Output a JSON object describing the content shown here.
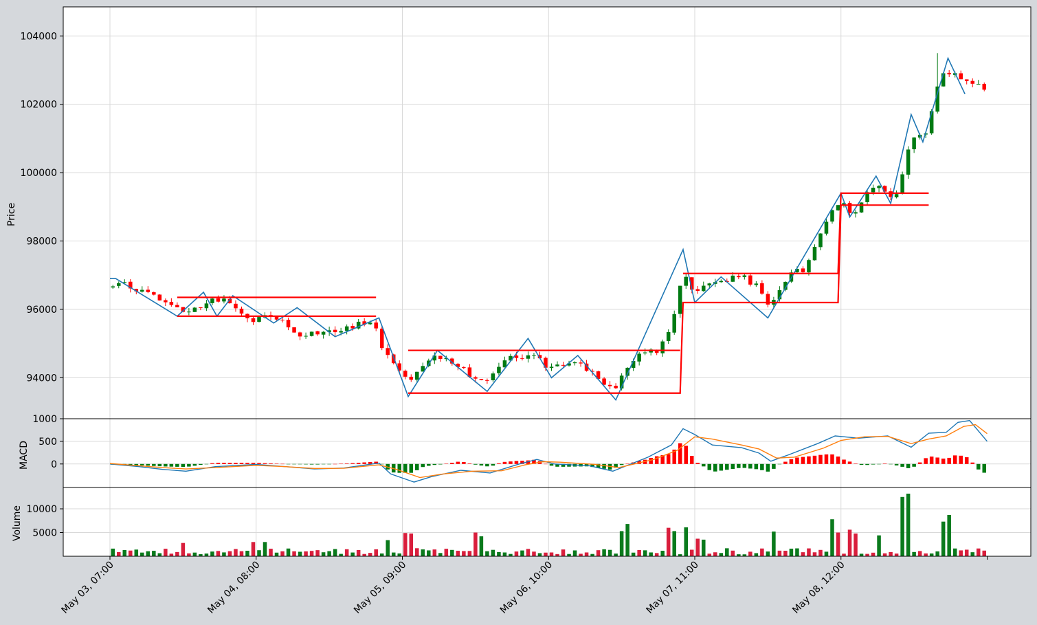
{
  "colors": {
    "figure_bg": "#d5d8dc",
    "panel_bg": "#ffffff",
    "grid": "#d9d9d9",
    "up": "#007a12",
    "down": "#ff0000",
    "volume_up": "#0a7a1c",
    "volume_down": "#d91e3c",
    "zigzag": "#1f77b4",
    "signal": "#ff7f0e",
    "levels": "#ff0000"
  },
  "chart_data": {
    "type": "candlestick",
    "x_tick_labels": [
      "May 03, 07:00",
      "May 04, 08:00",
      "May 05, 09:00",
      "May 06, 10:00",
      "May 07, 11:00",
      "May 08, 12:00"
    ],
    "x_tick_index": [
      0,
      25,
      50,
      75,
      100,
      125
    ],
    "bar_count": 150,
    "panels": {
      "price": {
        "ylabel": "Price",
        "yticks": [
          94000,
          96000,
          98000,
          100000,
          102000,
          104000
        ],
        "ylim": [
          92800,
          104850
        ],
        "anchors": [
          [
            0,
            96650
          ],
          [
            2,
            96800
          ],
          [
            11,
            96050
          ],
          [
            14,
            95950
          ],
          [
            17,
            96300
          ],
          [
            20,
            96250
          ],
          [
            24,
            95700
          ],
          [
            28,
            95850
          ],
          [
            32,
            95300
          ],
          [
            36,
            95250
          ],
          [
            40,
            95450
          ],
          [
            45,
            95650
          ],
          [
            47,
            94700
          ],
          [
            49,
            94300
          ],
          [
            51,
            93900
          ],
          [
            56,
            94650
          ],
          [
            60,
            94300
          ],
          [
            64,
            93800
          ],
          [
            67,
            94500
          ],
          [
            72,
            94700
          ],
          [
            75,
            94300
          ],
          [
            80,
            94400
          ],
          [
            86,
            93650
          ],
          [
            90,
            94700
          ],
          [
            94,
            94800
          ],
          [
            96,
            95500
          ],
          [
            98,
            97000
          ],
          [
            100,
            96500
          ],
          [
            104,
            96800
          ],
          [
            108,
            97000
          ],
          [
            111,
            96600
          ],
          [
            113,
            96100
          ],
          [
            116,
            97000
          ],
          [
            119,
            97200
          ],
          [
            123,
            98700
          ],
          [
            125,
            99200
          ],
          [
            127,
            98800
          ],
          [
            131,
            99700
          ],
          [
            134,
            99100
          ],
          [
            137,
            100900
          ],
          [
            140,
            101300
          ],
          [
            142,
            103000
          ],
          [
            144,
            102900
          ],
          [
            146,
            102700
          ],
          [
            149,
            102500
          ]
        ],
        "zigzag": [
          [
            0,
            96900
          ],
          [
            1,
            96900
          ],
          [
            11.5,
            95800
          ],
          [
            16,
            96500
          ],
          [
            18.3,
            95800
          ],
          [
            21,
            96400
          ],
          [
            28,
            95600
          ],
          [
            32,
            96050
          ],
          [
            38.5,
            95200
          ],
          [
            46,
            95750
          ],
          [
            51,
            93450
          ],
          [
            56,
            94800
          ],
          [
            64.5,
            93600
          ],
          [
            71.5,
            95150
          ],
          [
            75.5,
            94000
          ],
          [
            80,
            94650
          ],
          [
            86.5,
            93350
          ],
          [
            98,
            97750
          ],
          [
            100,
            96200
          ],
          [
            104.5,
            96950
          ],
          [
            112.5,
            95750
          ],
          [
            125,
            99400
          ],
          [
            126.5,
            98700
          ],
          [
            131,
            99900
          ],
          [
            133.5,
            99100
          ],
          [
            137,
            101700
          ],
          [
            139,
            100900
          ],
          [
            143.3,
            103350
          ],
          [
            146.2,
            102300
          ]
        ],
        "levels": [
          [
            [
              11.5,
              96350
            ],
            [
              45.5,
              96350
            ]
          ],
          [
            [
              11.5,
              95800
            ],
            [
              45.5,
              95800
            ]
          ],
          [
            [
              51,
              94800
            ],
            [
              97.5,
              94800
            ],
            [
              97.5,
              94800
            ]
          ],
          [
            [
              51,
              93550
            ],
            [
              97.5,
              93550
            ],
            [
              98,
              96200
            ],
            [
              124.5,
              96200
            ],
            [
              125,
              99050
            ],
            [
              140,
              99050
            ]
          ],
          [
            [
              98,
              97050
            ],
            [
              124.5,
              97050
            ],
            [
              125,
              99400
            ],
            [
              140,
              99400
            ]
          ]
        ]
      },
      "macd": {
        "ylabel": "MACD",
        "yticks": [
          0,
          500,
          1000
        ],
        "ylim": [
          -520,
          1000
        ],
        "macd_line": [
          [
            0,
            0
          ],
          [
            5,
            -60
          ],
          [
            9,
            -120
          ],
          [
            13,
            -160
          ],
          [
            18,
            -60
          ],
          [
            25,
            -10
          ],
          [
            30,
            -60
          ],
          [
            35,
            -110
          ],
          [
            40,
            -90
          ],
          [
            46,
            20
          ],
          [
            48,
            -220
          ],
          [
            52,
            -400
          ],
          [
            55,
            -280
          ],
          [
            60,
            -140
          ],
          [
            65,
            -200
          ],
          [
            70,
            0
          ],
          [
            73,
            100
          ],
          [
            76,
            0
          ],
          [
            82,
            -40
          ],
          [
            86,
            -160
          ],
          [
            92,
            150
          ],
          [
            96,
            420
          ],
          [
            98,
            780
          ],
          [
            100,
            650
          ],
          [
            103,
            420
          ],
          [
            108,
            360
          ],
          [
            111,
            240
          ],
          [
            113,
            60
          ],
          [
            116,
            200
          ],
          [
            121,
            450
          ],
          [
            124,
            620
          ],
          [
            128,
            570
          ],
          [
            133,
            620
          ],
          [
            137,
            370
          ],
          [
            140,
            680
          ],
          [
            143,
            700
          ],
          [
            145,
            920
          ],
          [
            147,
            960
          ],
          [
            150,
            500
          ]
        ],
        "signal_line": [
          [
            0,
            10
          ],
          [
            5,
            -40
          ],
          [
            9,
            -80
          ],
          [
            13,
            -110
          ],
          [
            18,
            -80
          ],
          [
            25,
            -30
          ],
          [
            30,
            -60
          ],
          [
            35,
            -100
          ],
          [
            40,
            -95
          ],
          [
            46,
            -20
          ],
          [
            49,
            -120
          ],
          [
            53,
            -300
          ],
          [
            57,
            -220
          ],
          [
            62,
            -160
          ],
          [
            67,
            -150
          ],
          [
            71,
            -20
          ],
          [
            74,
            50
          ],
          [
            77,
            40
          ],
          [
            83,
            -10
          ],
          [
            87,
            -80
          ],
          [
            93,
            100
          ],
          [
            97,
            300
          ],
          [
            100,
            600
          ],
          [
            103,
            550
          ],
          [
            108,
            420
          ],
          [
            111,
            330
          ],
          [
            114,
            130
          ],
          [
            117,
            150
          ],
          [
            122,
            350
          ],
          [
            125,
            520
          ],
          [
            129,
            600
          ],
          [
            133,
            610
          ],
          [
            137,
            450
          ],
          [
            140,
            550
          ],
          [
            143,
            620
          ],
          [
            146,
            830
          ],
          [
            148,
            870
          ],
          [
            150,
            670
          ]
        ]
      },
      "volume": {
        "ylabel": "Volume",
        "yticks": [
          5000,
          10000
        ],
        "ylim": [
          0,
          14500
        ],
        "spikes": [
          [
            12,
            2800
          ],
          [
            24,
            3000
          ],
          [
            26,
            3000
          ],
          [
            47,
            3400
          ],
          [
            50,
            4900
          ],
          [
            51,
            4800
          ],
          [
            62,
            5000
          ],
          [
            63,
            4200
          ],
          [
            87,
            5300
          ],
          [
            88,
            6800
          ],
          [
            95,
            6000
          ],
          [
            96,
            5300
          ],
          [
            98,
            6100
          ],
          [
            100,
            3700
          ],
          [
            101,
            3500
          ],
          [
            113,
            5200
          ],
          [
            123,
            7800
          ],
          [
            124,
            5000
          ],
          [
            126,
            5600
          ],
          [
            127,
            4800
          ],
          [
            131,
            4400
          ],
          [
            135,
            12500
          ],
          [
            136,
            13200
          ],
          [
            142,
            7300
          ],
          [
            143,
            8700
          ]
        ]
      }
    }
  }
}
